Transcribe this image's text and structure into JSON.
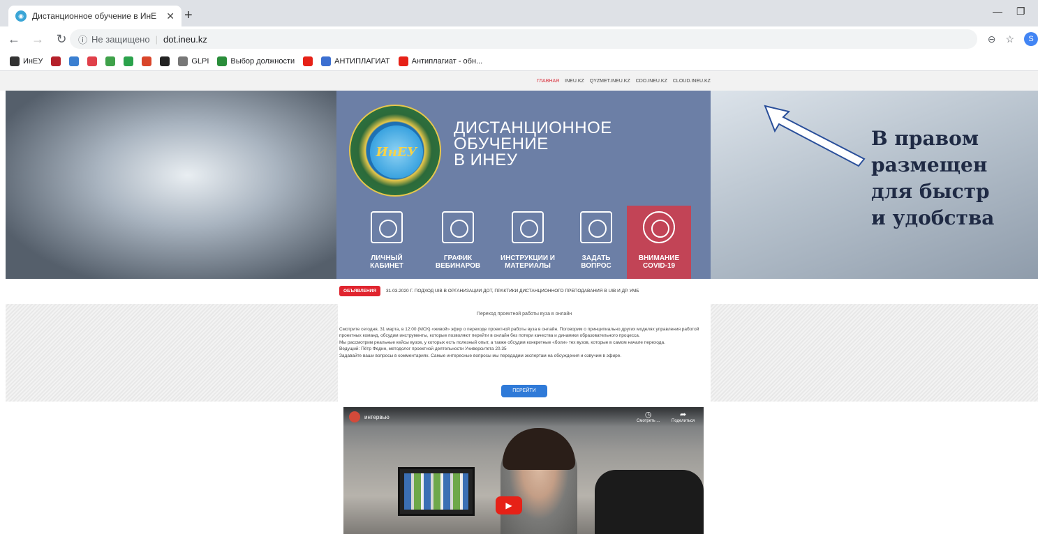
{
  "browser": {
    "tab_title": "Дистанционное обучение в ИнЕ",
    "tab_close": "✕",
    "new_tab": "+",
    "security_label": "Не защищено",
    "url": "dot.ineu.kz",
    "profile_initial": "S"
  },
  "bookmarks": [
    {
      "label": "ИнЕУ",
      "color": "#333333"
    },
    {
      "label": "",
      "color": "#b5202a"
    },
    {
      "label": "",
      "color": "#3b7fd1"
    },
    {
      "label": "",
      "color": "#e0404a"
    },
    {
      "label": "",
      "color": "#3fa14a"
    },
    {
      "label": "",
      "color": "#2ba24c"
    },
    {
      "label": "",
      "color": "#d9452a"
    },
    {
      "label": "",
      "color": "#222222"
    },
    {
      "label": "GLPI",
      "color": "#777777"
    },
    {
      "label": "Выбор должности",
      "color": "#2a8d3a"
    },
    {
      "label": "",
      "color": "#e62117"
    },
    {
      "label": "АНТИПЛАГИАТ",
      "color": "#3b6fd1"
    },
    {
      "label": "Антиплагиат - обн...",
      "color": "#e62117"
    }
  ],
  "topnav": {
    "items": [
      "ГЛАВНАЯ",
      "INEU.KZ",
      "QYZMET.INEU.KZ",
      "CDO.INEU.KZ",
      "CLOUD.INEU.KZ"
    ]
  },
  "hero": {
    "logo_text": "ИнЕУ",
    "title_line1": "ДИСТАНЦИОННОЕ",
    "title_line2": "ОБУЧЕНИЕ",
    "title_line3": "В ИНЕУ",
    "menu": [
      {
        "line1": "ЛИЧНЫЙ",
        "line2": "КАБИНЕТ"
      },
      {
        "line1": "ГРАФИК",
        "line2": "ВЕБИНАРОВ"
      },
      {
        "line1": "ИНСТРУКЦИИ И",
        "line2": "МАТЕРИАЛЫ"
      },
      {
        "line1": "ЗАДАТЬ",
        "line2": "ВОПРОС"
      },
      {
        "line1": "ВНИМАНИЕ",
        "line2": "COVID-19"
      }
    ]
  },
  "callout": {
    "line1": "В правом",
    "line2": "размещен",
    "line3": "для быстр",
    "line4": "и удобства"
  },
  "ticker": {
    "badge": "ОБЪЯВЛЕНИЯ",
    "text": "31.03.2020 Г. ПОДХОД UIB В ОРГАНИЗАЦИИ ДОТ, ПРАКТИКИ ДИСТАНЦИОННОГО ПРЕПОДАВАНИЯ В UIB И ДР. УМБ"
  },
  "article": {
    "title": "Переход проектной работы вуза в онлайн",
    "p1": "Смотрите сегодня, 31 марта, в 12:00 (МСК) «живой» эфир о переходе проектной работы вуза в онлайн. Поговорим о принципиально других моделях управления работой проектных команд, обсудим инструменты, которые позволяют перейти в онлайн без потери качества и динамики образовательного процесса.",
    "p2": "Мы рассмотрим реальные кейсы вузов, у которых есть полезный опыт, а также обсудим конкретные «боли» тех вузов, которые в самом начале перехода.",
    "p3": "Ведущий: Пётр Федин, методолог проектной деятельности Университета 20.35",
    "p4": "Задавайте ваши вопросы в комментариях. Самые интересные вопросы мы передадим экспертам на обсуждения и озвучим в эфире.",
    "button": "ПЕРЕЙТИ"
  },
  "video": {
    "title": "интервью",
    "watch_later": "Смотреть ...",
    "share": "Поделиться"
  }
}
